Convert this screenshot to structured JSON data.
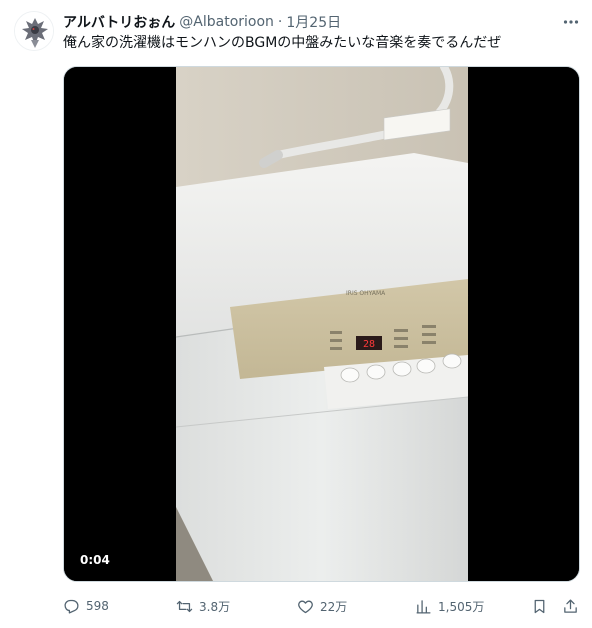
{
  "author": {
    "display_name": "アルバトリおぉん",
    "handle": "@Albatorioon",
    "separator": "·",
    "date": "1月25日"
  },
  "tweet": {
    "text": "俺ん家の洗濯機はモンハンのBGMの中盤みたいな音楽を奏でるんだぜ"
  },
  "media": {
    "type": "video",
    "timestamp": "0:04",
    "appliance_brand": "IRIS OHYAMA",
    "display_readout": "28",
    "button_labels": [
      "水位",
      "予約",
      "洗い",
      "すすぎ",
      "脱水"
    ]
  },
  "actions": {
    "reply": {
      "icon": "reply-icon",
      "count": "598"
    },
    "retweet": {
      "icon": "retweet-icon",
      "count": "3.8万"
    },
    "like": {
      "icon": "heart-icon",
      "count": "22万"
    },
    "views": {
      "icon": "views-icon",
      "count": "1,505万"
    },
    "bookmark": {
      "icon": "bookmark-icon"
    },
    "share": {
      "icon": "share-icon"
    }
  },
  "colors": {
    "text_primary": "#0f1419",
    "text_secondary": "#536471",
    "border": "#cfd9de",
    "video_bg": "#000000"
  }
}
